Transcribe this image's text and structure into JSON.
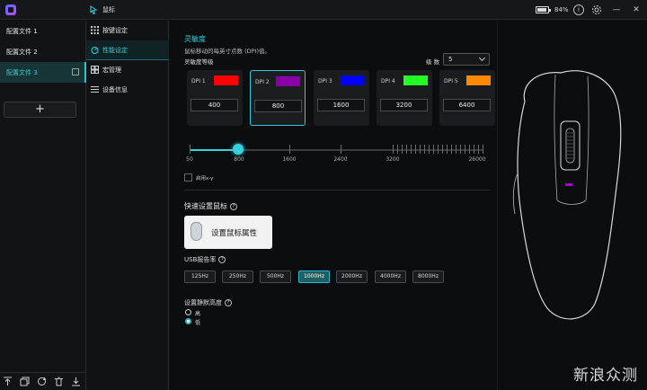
{
  "titlebar": {
    "title": "鼠标",
    "battery_pct": "84%"
  },
  "profiles": {
    "items": [
      "配置文件 1",
      "配置文件 2",
      "配置文件 3"
    ],
    "add_label": "+"
  },
  "nav": {
    "items": [
      "按键设定",
      "性能设定",
      "宏管理",
      "设备信息"
    ]
  },
  "sensitivity": {
    "title": "灵敏度",
    "description": "鼠标移动的每英寸点数 (DPI)值。",
    "levels_label": "灵敏度等级",
    "level_count_label": "级 数",
    "level_count": "5",
    "dpi_levels": [
      {
        "label": "DPI 1",
        "value": "400",
        "color": "#ff0000"
      },
      {
        "label": "DPI 2",
        "value": "800",
        "color": "#8a00a8"
      },
      {
        "label": "DPI 3",
        "value": "1600",
        "color": "#0000ff"
      },
      {
        "label": "DPI 4",
        "value": "3200",
        "color": "#22ff22"
      },
      {
        "label": "DPI 5",
        "value": "6400",
        "color": "#ff8a00"
      }
    ],
    "slider": {
      "ticks": [
        "50",
        "800",
        "1600",
        "2400",
        "3200",
        "26000"
      ],
      "current": "800"
    },
    "xy_label": "启用x-y"
  },
  "quick": {
    "title": "快速设置鼠标",
    "button_label": "设置鼠标属性"
  },
  "usb": {
    "title": "USB报告率",
    "rates": [
      "125Hz",
      "250Hz",
      "500Hz",
      "1000Hz",
      "2000Hz",
      "4000Hz",
      "8000Hz"
    ],
    "selected": "1000Hz"
  },
  "silent": {
    "title": "设置静默高度",
    "options": [
      "高",
      "低"
    ],
    "selected": "低"
  },
  "watermark": "新浪众测",
  "colors": {
    "accent": "#36d1dc",
    "background": "#0c0d0f"
  }
}
